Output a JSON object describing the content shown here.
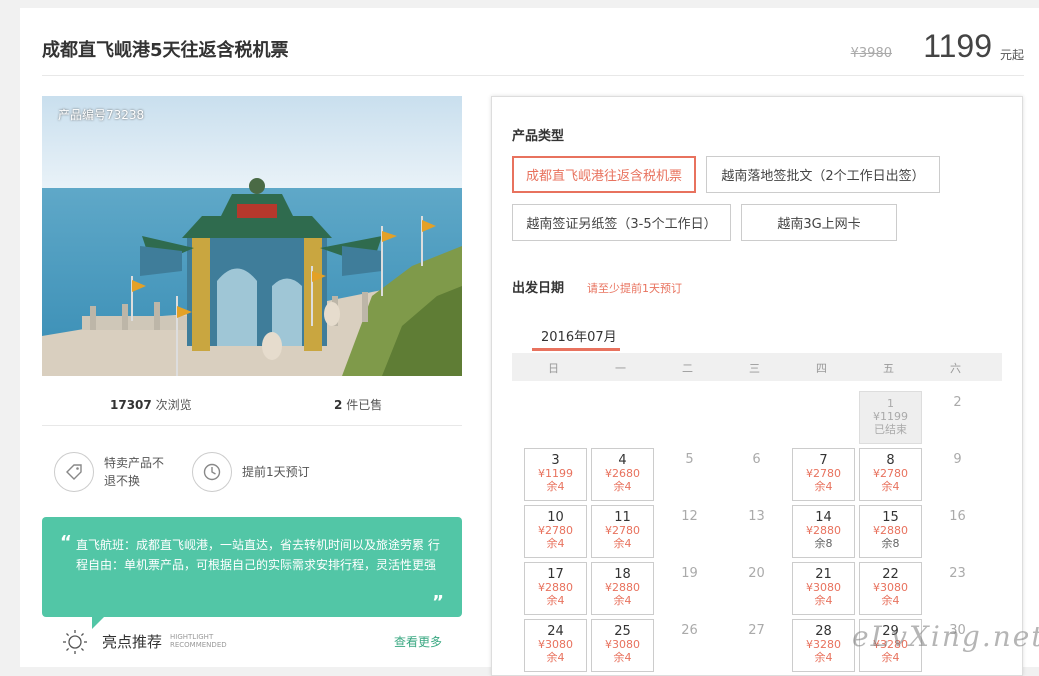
{
  "product": {
    "title": "成都直飞岘港5天往返含税机票",
    "original_price": "¥3980",
    "price": "1199",
    "price_suffix": "元起",
    "product_no": "产品编号73238"
  },
  "stats": {
    "views_count": "17307",
    "views_label": "次浏览",
    "sold_count": "2",
    "sold_label": "件已售"
  },
  "features": [
    {
      "icon": "tag-icon",
      "text": "特卖产品不退不换"
    },
    {
      "icon": "clock-icon",
      "text": "提前1天预订"
    }
  ],
  "quote": {
    "text": "直飞航班：成都直飞岘港，一站直达，省去转机时间以及旅途劳累 行程自由：单机票产品，可根据自己的实际需求安排行程，灵活性更强"
  },
  "highlight": {
    "title": "亮点推荐",
    "en_line1": "HIGHTLIGHT",
    "en_line2": "RECOMMENDED",
    "more": "查看更多"
  },
  "booking": {
    "type_label": "产品类型",
    "options": [
      {
        "label": "成都直飞岘港往返含税机票",
        "selected": true
      },
      {
        "label": "越南落地签批文（2个工作日出签）",
        "selected": false
      },
      {
        "label": "越南签证另纸签（3-5个工作日）",
        "selected": false
      },
      {
        "label": "越南3G上网卡",
        "selected": false
      }
    ],
    "date_label": "出发日期",
    "date_notice": "请至少提前1天预订",
    "month": "2016年07月",
    "weekdays": [
      "日",
      "一",
      "二",
      "三",
      "四",
      "五",
      "六"
    ]
  },
  "calendar": [
    {
      "day": "1",
      "col": 5,
      "row": 0,
      "state": "past",
      "price": "¥1199",
      "stock": "已结束"
    },
    {
      "day": "2",
      "col": 6,
      "row": 0,
      "state": "empty"
    },
    {
      "day": "3",
      "col": 0,
      "row": 1,
      "state": "avail",
      "price": "¥1199",
      "stock": "余4"
    },
    {
      "day": "4",
      "col": 1,
      "row": 1,
      "state": "avail",
      "price": "¥2680",
      "stock": "余4"
    },
    {
      "day": "5",
      "col": 2,
      "row": 1,
      "state": "empty"
    },
    {
      "day": "6",
      "col": 3,
      "row": 1,
      "state": "empty"
    },
    {
      "day": "7",
      "col": 4,
      "row": 1,
      "state": "avail",
      "price": "¥2780",
      "stock": "余4"
    },
    {
      "day": "8",
      "col": 5,
      "row": 1,
      "state": "avail",
      "price": "¥2780",
      "stock": "余4"
    },
    {
      "day": "9",
      "col": 6,
      "row": 1,
      "state": "empty"
    },
    {
      "day": "10",
      "col": 0,
      "row": 2,
      "state": "avail",
      "price": "¥2780",
      "stock": "余4"
    },
    {
      "day": "11",
      "col": 1,
      "row": 2,
      "state": "avail",
      "price": "¥2780",
      "stock": "余4"
    },
    {
      "day": "12",
      "col": 2,
      "row": 2,
      "state": "empty"
    },
    {
      "day": "13",
      "col": 3,
      "row": 2,
      "state": "empty"
    },
    {
      "day": "14",
      "col": 4,
      "row": 2,
      "state": "avail",
      "price": "¥2880",
      "stock": "余8",
      "stock_gray": true
    },
    {
      "day": "15",
      "col": 5,
      "row": 2,
      "state": "avail",
      "price": "¥2880",
      "stock": "余8",
      "stock_gray": true
    },
    {
      "day": "16",
      "col": 6,
      "row": 2,
      "state": "empty"
    },
    {
      "day": "17",
      "col": 0,
      "row": 3,
      "state": "avail",
      "price": "¥2880",
      "stock": "余4"
    },
    {
      "day": "18",
      "col": 1,
      "row": 3,
      "state": "avail",
      "price": "¥2880",
      "stock": "余4"
    },
    {
      "day": "19",
      "col": 2,
      "row": 3,
      "state": "empty"
    },
    {
      "day": "20",
      "col": 3,
      "row": 3,
      "state": "empty"
    },
    {
      "day": "21",
      "col": 4,
      "row": 3,
      "state": "avail",
      "price": "¥3080",
      "stock": "余4"
    },
    {
      "day": "22",
      "col": 5,
      "row": 3,
      "state": "avail",
      "price": "¥3080",
      "stock": "余4"
    },
    {
      "day": "23",
      "col": 6,
      "row": 3,
      "state": "empty"
    },
    {
      "day": "24",
      "col": 0,
      "row": 4,
      "state": "avail",
      "price": "¥3080",
      "stock": "余4"
    },
    {
      "day": "25",
      "col": 1,
      "row": 4,
      "state": "avail",
      "price": "¥3080",
      "stock": "余4"
    },
    {
      "day": "26",
      "col": 2,
      "row": 4,
      "state": "empty"
    },
    {
      "day": "27",
      "col": 3,
      "row": 4,
      "state": "empty"
    },
    {
      "day": "28",
      "col": 4,
      "row": 4,
      "state": "avail",
      "price": "¥3280",
      "stock": "余4"
    },
    {
      "day": "29",
      "col": 5,
      "row": 4,
      "state": "avail",
      "price": "¥3280",
      "stock": "余4"
    },
    {
      "day": "30",
      "col": 6,
      "row": 4,
      "state": "empty"
    }
  ],
  "watermark": "eLvXing.net"
}
